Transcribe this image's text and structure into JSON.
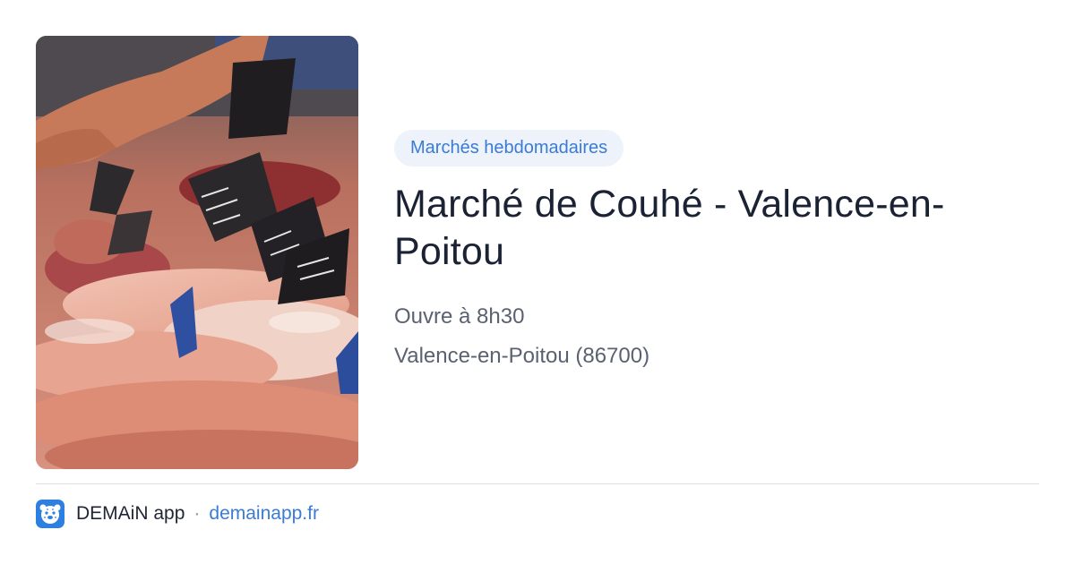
{
  "card": {
    "image_alt": "Étal de poissonnier avec ardoises de prix",
    "category": "Marchés hebdomadaires",
    "title": "Marché de Couhé - Valence-en-Poitou",
    "hours": "Ouvre à 8h30",
    "location": "Valence-en-Poitou (86700)"
  },
  "footer": {
    "app_icon": "leopard-face-icon",
    "app_name": "DEMAiN app",
    "separator": "·",
    "site": "demainapp.fr"
  },
  "colors": {
    "accent": "#3a7bd5",
    "badge_bg": "#eef3fb",
    "app_icon_bg": "#2f7fe0",
    "title": "#1a2233",
    "meta": "#5a6170"
  }
}
